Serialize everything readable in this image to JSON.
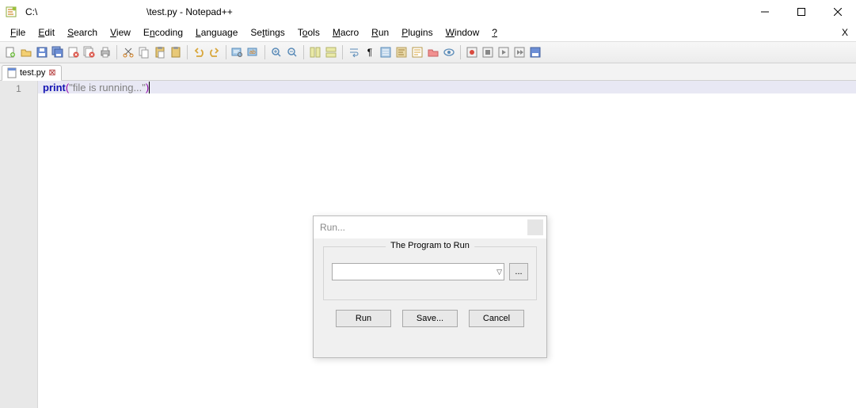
{
  "titlebar": {
    "path": "C:\\",
    "doc_title": "\\test.py - Notepad++"
  },
  "menu": {
    "items": [
      "File",
      "Edit",
      "Search",
      "View",
      "Encoding",
      "Language",
      "Settings",
      "Tools",
      "Macro",
      "Run",
      "Plugins",
      "Window",
      "?"
    ]
  },
  "tab": {
    "label": "test.py"
  },
  "editor": {
    "line_no": "1",
    "code_kw": "print",
    "code_paren_o": "(",
    "code_str": "\"file is running...\"",
    "code_paren_c": ")"
  },
  "dialog": {
    "title": "Run...",
    "legend": "The Program to Run",
    "combo_value": "",
    "browse_label": "...",
    "run_label": "Run",
    "save_label": "Save...",
    "cancel_label": "Cancel"
  },
  "toolbar_icons": [
    "new",
    "open",
    "save",
    "save-all",
    "close",
    "close-all",
    "print",
    "cut",
    "copy",
    "paste",
    "clipboard",
    "undo",
    "redo",
    "find",
    "replace",
    "zoom-in",
    "zoom-out",
    "sync",
    "wrap",
    "all-chars",
    "indent",
    "outdent",
    "ws",
    "eol",
    "folder",
    "view",
    "record",
    "stop",
    "play",
    "play-mult",
    "fast"
  ]
}
